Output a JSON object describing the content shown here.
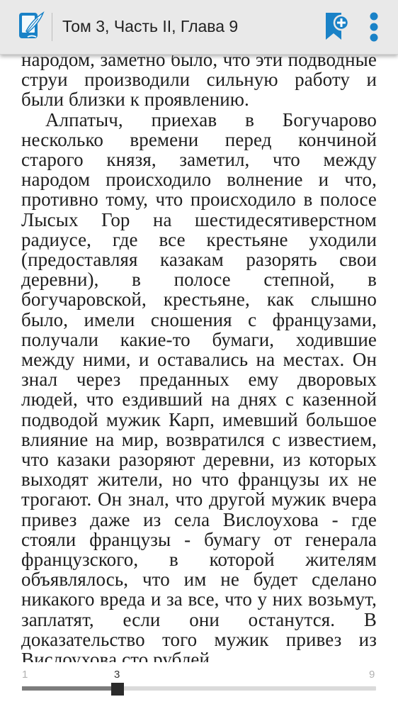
{
  "app_bar": {
    "title": "Том 3, Часть II, Глава 9",
    "app_icon": "book-quill-icon",
    "add_bookmark_icon": "bookmark-add-icon",
    "menu_icon": "more-vertical-icon",
    "background": "#e9e9e9",
    "accent": "#1a82c7"
  },
  "page_text": {
    "paragraphs": [
      "народом, заметно было, что эти подводные струи производили сильную работу и были близки к проявлению.",
      "Алпатыч, приехав в Богучарово несколько времени перед кончиной старого князя, заметил, что между народом происходило волнение и что, противно тому, что происходило в полосе Лысых Гор на шестидесятиверстном радиусе, где все крестьяне уходили (предоставляя казакам разорять свои деревни), в полосе степной, в богучаровской, крестьяне, как слышно было, имели сношения с французами, получали какие-то бумаги, ходившие между ними, и оставались на местах. Он знал через преданных ему дворовых людей, что ездивший на днях с казенной подводой мужик Карп, имевший большое влияние на мир, возвратился с известием, что казаки разоряют деревни, из которых выходят жители, но что французы их не трогают. Он знал, что другой мужик вчера привез даже из села Вислоухова - где стояли французы - бумагу от генерала французского, в которой жителям объявлялось, что им не будет сделано никакого вреда и за все, что у них возьмут, заплатят, если они останутся. В доказательство того мужик привез из Вислоухова сто рублей"
    ]
  },
  "page_slider": {
    "min_label": "1",
    "current_label": "3",
    "max_label": "9",
    "min": 1,
    "max": 9,
    "current": 3,
    "progress_fraction": 0.27
  }
}
